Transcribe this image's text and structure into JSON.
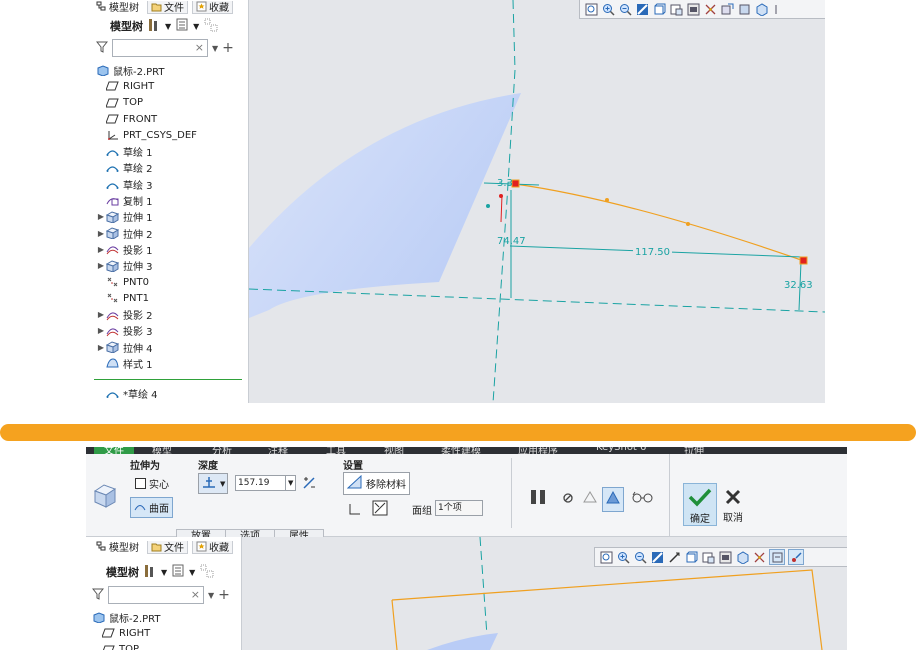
{
  "top_screenshot": {
    "tabs": [
      {
        "label": "模型树",
        "icon": "tree-icon"
      },
      {
        "label": "文件",
        "icon": "folder-icon"
      },
      {
        "label": "收藏",
        "icon": "star-icon"
      }
    ],
    "tree_toolbar_label": "模型树",
    "search": {
      "value": "",
      "clear": "×"
    },
    "tree_items": [
      {
        "label": "鼠标-2.PRT",
        "icon": "part-icon",
        "expandable": false,
        "indent": 0
      },
      {
        "label": "RIGHT",
        "icon": "datum-plane-icon",
        "expandable": false,
        "indent": 1
      },
      {
        "label": "TOP",
        "icon": "datum-plane-icon",
        "expandable": false,
        "indent": 1
      },
      {
        "label": "FRONT",
        "icon": "datum-plane-icon",
        "expandable": false,
        "indent": 1
      },
      {
        "label": "PRT_CSYS_DEF",
        "icon": "csys-icon",
        "expandable": false,
        "indent": 1
      },
      {
        "label": "草绘 1",
        "icon": "sketch-icon",
        "expandable": false,
        "indent": 1
      },
      {
        "label": "草绘 2",
        "icon": "sketch-icon",
        "expandable": false,
        "indent": 1
      },
      {
        "label": "草绘 3",
        "icon": "sketch-icon",
        "expandable": false,
        "indent": 1
      },
      {
        "label": "复制 1",
        "icon": "copy-icon",
        "expandable": false,
        "indent": 1
      },
      {
        "label": "拉伸 1",
        "icon": "extrude-icon",
        "expandable": true,
        "indent": 1
      },
      {
        "label": "拉伸 2",
        "icon": "extrude-icon",
        "expandable": true,
        "indent": 1
      },
      {
        "label": "投影 1",
        "icon": "projection-icon",
        "expandable": true,
        "indent": 1
      },
      {
        "label": "拉伸 3",
        "icon": "extrude-icon",
        "expandable": true,
        "indent": 1
      },
      {
        "label": "PNT0",
        "icon": "point-icon",
        "expandable": false,
        "indent": 1
      },
      {
        "label": "PNT1",
        "icon": "point-icon",
        "expandable": false,
        "indent": 1
      },
      {
        "label": "投影 2",
        "icon": "projection-icon",
        "expandable": true,
        "indent": 1
      },
      {
        "label": "投影 3",
        "icon": "projection-icon",
        "expandable": true,
        "indent": 1
      },
      {
        "label": "拉伸 4",
        "icon": "extrude-icon",
        "expandable": true,
        "indent": 1
      },
      {
        "label": "样式 1",
        "icon": "style-icon",
        "expandable": false,
        "indent": 1
      }
    ],
    "active_item": {
      "label": "*草绘 4",
      "icon": "sketch-icon"
    },
    "dimensions": {
      "d1": "3.3",
      "d2": "74.47",
      "d3": "117.50",
      "d4": "32.63"
    },
    "colors": {
      "curve": "#f0a020",
      "dimension": "#1aa3a3",
      "surface": "#c7d5f7",
      "handle": "#e02020"
    }
  },
  "separator_color": "#f5a21f",
  "bottom_screenshot": {
    "menu": [
      "文件",
      "模型",
      "分析",
      "注释",
      "工具",
      "视图",
      "柔性建模",
      "应用程序",
      "KeyShot 6",
      "拉伸"
    ],
    "extrude_as_label": "拉伸为",
    "solid_label": "实心",
    "surface_label": "曲面",
    "depth_label": "深度",
    "depth_value": "157.19",
    "settings_label": "设置",
    "remove_material_label": "移除材料",
    "face_group_label": "面组",
    "face_group_value": "1个项",
    "subtabs": [
      "放置",
      "选项",
      "属性"
    ],
    "ok_label": "确定",
    "cancel_label": "取消",
    "tabs": [
      {
        "label": "模型树",
        "icon": "tree-icon"
      },
      {
        "label": "文件",
        "icon": "folder-icon"
      },
      {
        "label": "收藏",
        "icon": "star-icon"
      }
    ],
    "tree_toolbar_label": "模型树",
    "search": {
      "value": "",
      "clear": "×"
    },
    "tree_items": [
      {
        "label": "鼠标-2.PRT",
        "icon": "part-icon"
      },
      {
        "label": "RIGHT",
        "icon": "datum-plane-icon"
      },
      {
        "label": "TOP",
        "icon": "datum-plane-icon"
      }
    ]
  }
}
